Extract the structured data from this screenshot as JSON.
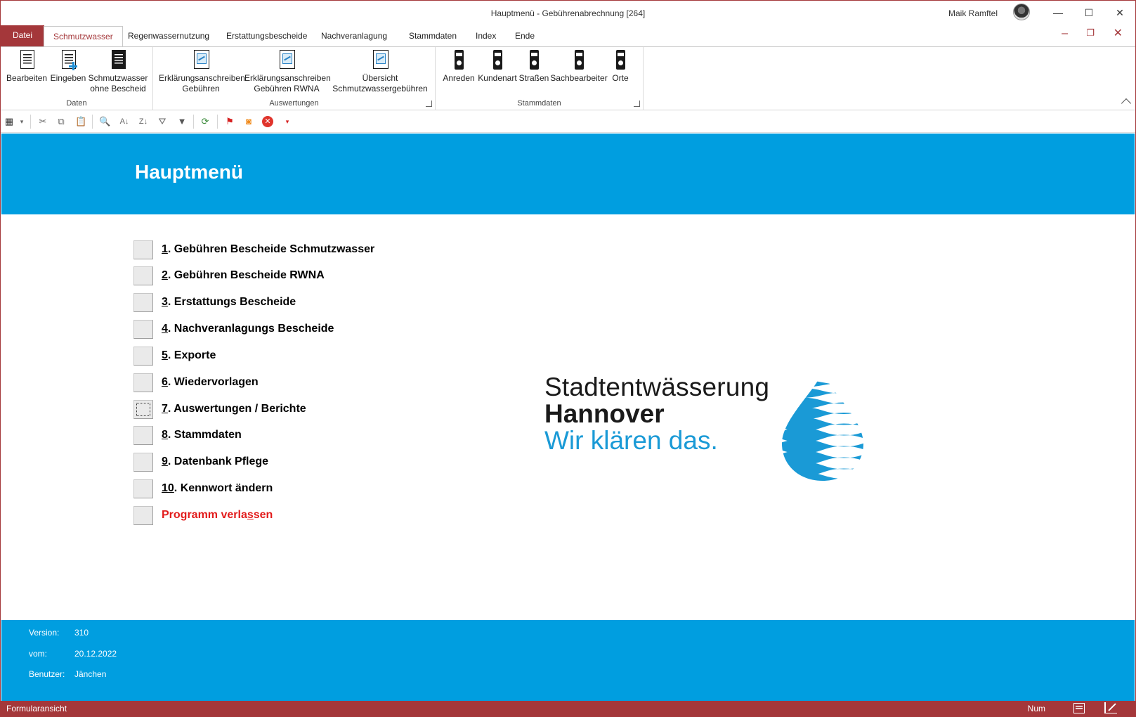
{
  "window": {
    "title": "Hauptmenü  -  Gebührenabrechnung [264]",
    "user": "Maik Ramftel",
    "minimize": "—",
    "maximize": "☐",
    "close": "✕",
    "doc_minimize": "–",
    "doc_restore": "❐",
    "doc_close": "✕"
  },
  "tabs": [
    {
      "label": "Datei"
    },
    {
      "label": "Schmutzwasser"
    },
    {
      "label": "Regenwassernutzung"
    },
    {
      "label": "Erstattungsbescheide"
    },
    {
      "label": "Nachveranlagung"
    },
    {
      "label": "Stammdaten"
    },
    {
      "label": "Index"
    },
    {
      "label": "Ende"
    }
  ],
  "ribbon": {
    "groups": [
      {
        "label": "Daten"
      },
      {
        "label": "Auswertungen"
      },
      {
        "label": "Stammdaten"
      }
    ],
    "daten": {
      "bearbeiten": "Bearbeiten",
      "eingeben": "Eingeben",
      "schmutzwasser_l1": "Schmutzwasser",
      "schmutzwasser_l2": "ohne Bescheid"
    },
    "auswertungen": {
      "erk1_l1": "Erklärungsanschreiben",
      "erk1_l2": "Gebühren",
      "erk2_l1": "Erklärungsanschreiben",
      "erk2_l2": "Gebühren RWNA",
      "ueb_l1": "Übersicht",
      "ueb_l2": "Schmutzwassergebühren"
    },
    "stammdaten": {
      "anreden": "Anreden",
      "kundenart": "Kundenart",
      "strassen": "Straßen",
      "sachbearbeiter": "Sachbearbeiter",
      "orte": "Orte"
    }
  },
  "qat": {
    "icons": [
      "view-icon",
      "cut-icon",
      "copy-icon",
      "paste-icon",
      "find-icon",
      "sort-asc-icon",
      "sort-desc-icon",
      "filter-advanced-icon",
      "filter-icon",
      "refresh-icon",
      "flag-icon",
      "rss-icon",
      "delete-icon",
      "customize-icon"
    ]
  },
  "form": {
    "title": "Hauptmenü",
    "menu": [
      {
        "num": "1",
        "text": ". Gebühren Bescheide Schmutzwasser"
      },
      {
        "num": "2",
        "text": ". Gebühren Bescheide RWNA"
      },
      {
        "num": "3",
        "text": ". Erstattungs Bescheide"
      },
      {
        "num": "4",
        "text": ". Nachveranlagungs Bescheide"
      },
      {
        "num": "5",
        "text": ". Exporte"
      },
      {
        "num": "6",
        "text": ". Wiedervorlagen"
      },
      {
        "num": "7",
        "text": ". Auswertungen / Berichte"
      },
      {
        "num": "8",
        "text": ". Stammdaten"
      },
      {
        "num": "9",
        "text": ". Datenbank Pflege"
      },
      {
        "num": "10",
        "text": ". Kennwort ändern"
      }
    ],
    "exit": {
      "pre": "Programm verla",
      "u": "s",
      "post": "sen"
    },
    "logo": {
      "line1": "Stadtentwässerung",
      "line2": "Hannover",
      "line3": "Wir klären das."
    },
    "footer": {
      "version_label": "Version:",
      "version": "310",
      "date_label": "vom:",
      "date": "20.12.2022",
      "user_label": "Benutzer:",
      "user": "Jänchen"
    }
  },
  "status": {
    "left": "Formularansicht",
    "num": "Num"
  },
  "colors": {
    "accent": "#a4373a",
    "band": "#009ee0",
    "exit": "#e21b1b"
  }
}
